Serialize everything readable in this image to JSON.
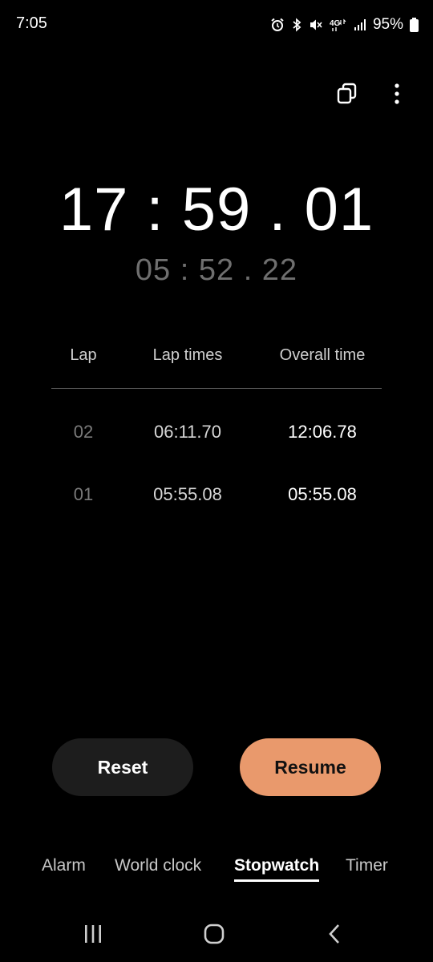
{
  "status_bar": {
    "time": "7:05",
    "battery_percent": "95%",
    "network": "4G",
    "icons": [
      "alarm-icon",
      "bluetooth-icon",
      "mute-icon",
      "network-4g-icon",
      "signal-icon",
      "battery-icon"
    ]
  },
  "top_actions": {
    "icons": [
      "popup-view-icon",
      "more-options-icon"
    ]
  },
  "stopwatch": {
    "total_time": "17 : 59 . 01",
    "current_lap_time": "05 : 52 . 22"
  },
  "laps": {
    "headers": {
      "lap": "Lap",
      "lap_times": "Lap times",
      "overall_time": "Overall time"
    },
    "rows": [
      {
        "lap": "02",
        "lap_time": "06:11.70",
        "overall_time": "12:06.78"
      },
      {
        "lap": "01",
        "lap_time": "05:55.08",
        "overall_time": "05:55.08"
      }
    ]
  },
  "buttons": {
    "reset_label": "Reset",
    "resume_label": "Resume"
  },
  "tabs": [
    {
      "label": "Alarm",
      "active": false
    },
    {
      "label": "World clock",
      "active": false
    },
    {
      "label": "Stopwatch",
      "active": true
    },
    {
      "label": "Timer",
      "active": false
    }
  ],
  "colors": {
    "background": "#000000",
    "accent_button": "#e9996c",
    "secondary_button": "#1d1d1d",
    "muted_text": "#6f6f6f"
  },
  "nav_bar": {
    "icons": [
      "recent-apps-icon",
      "home-icon",
      "back-icon"
    ]
  }
}
